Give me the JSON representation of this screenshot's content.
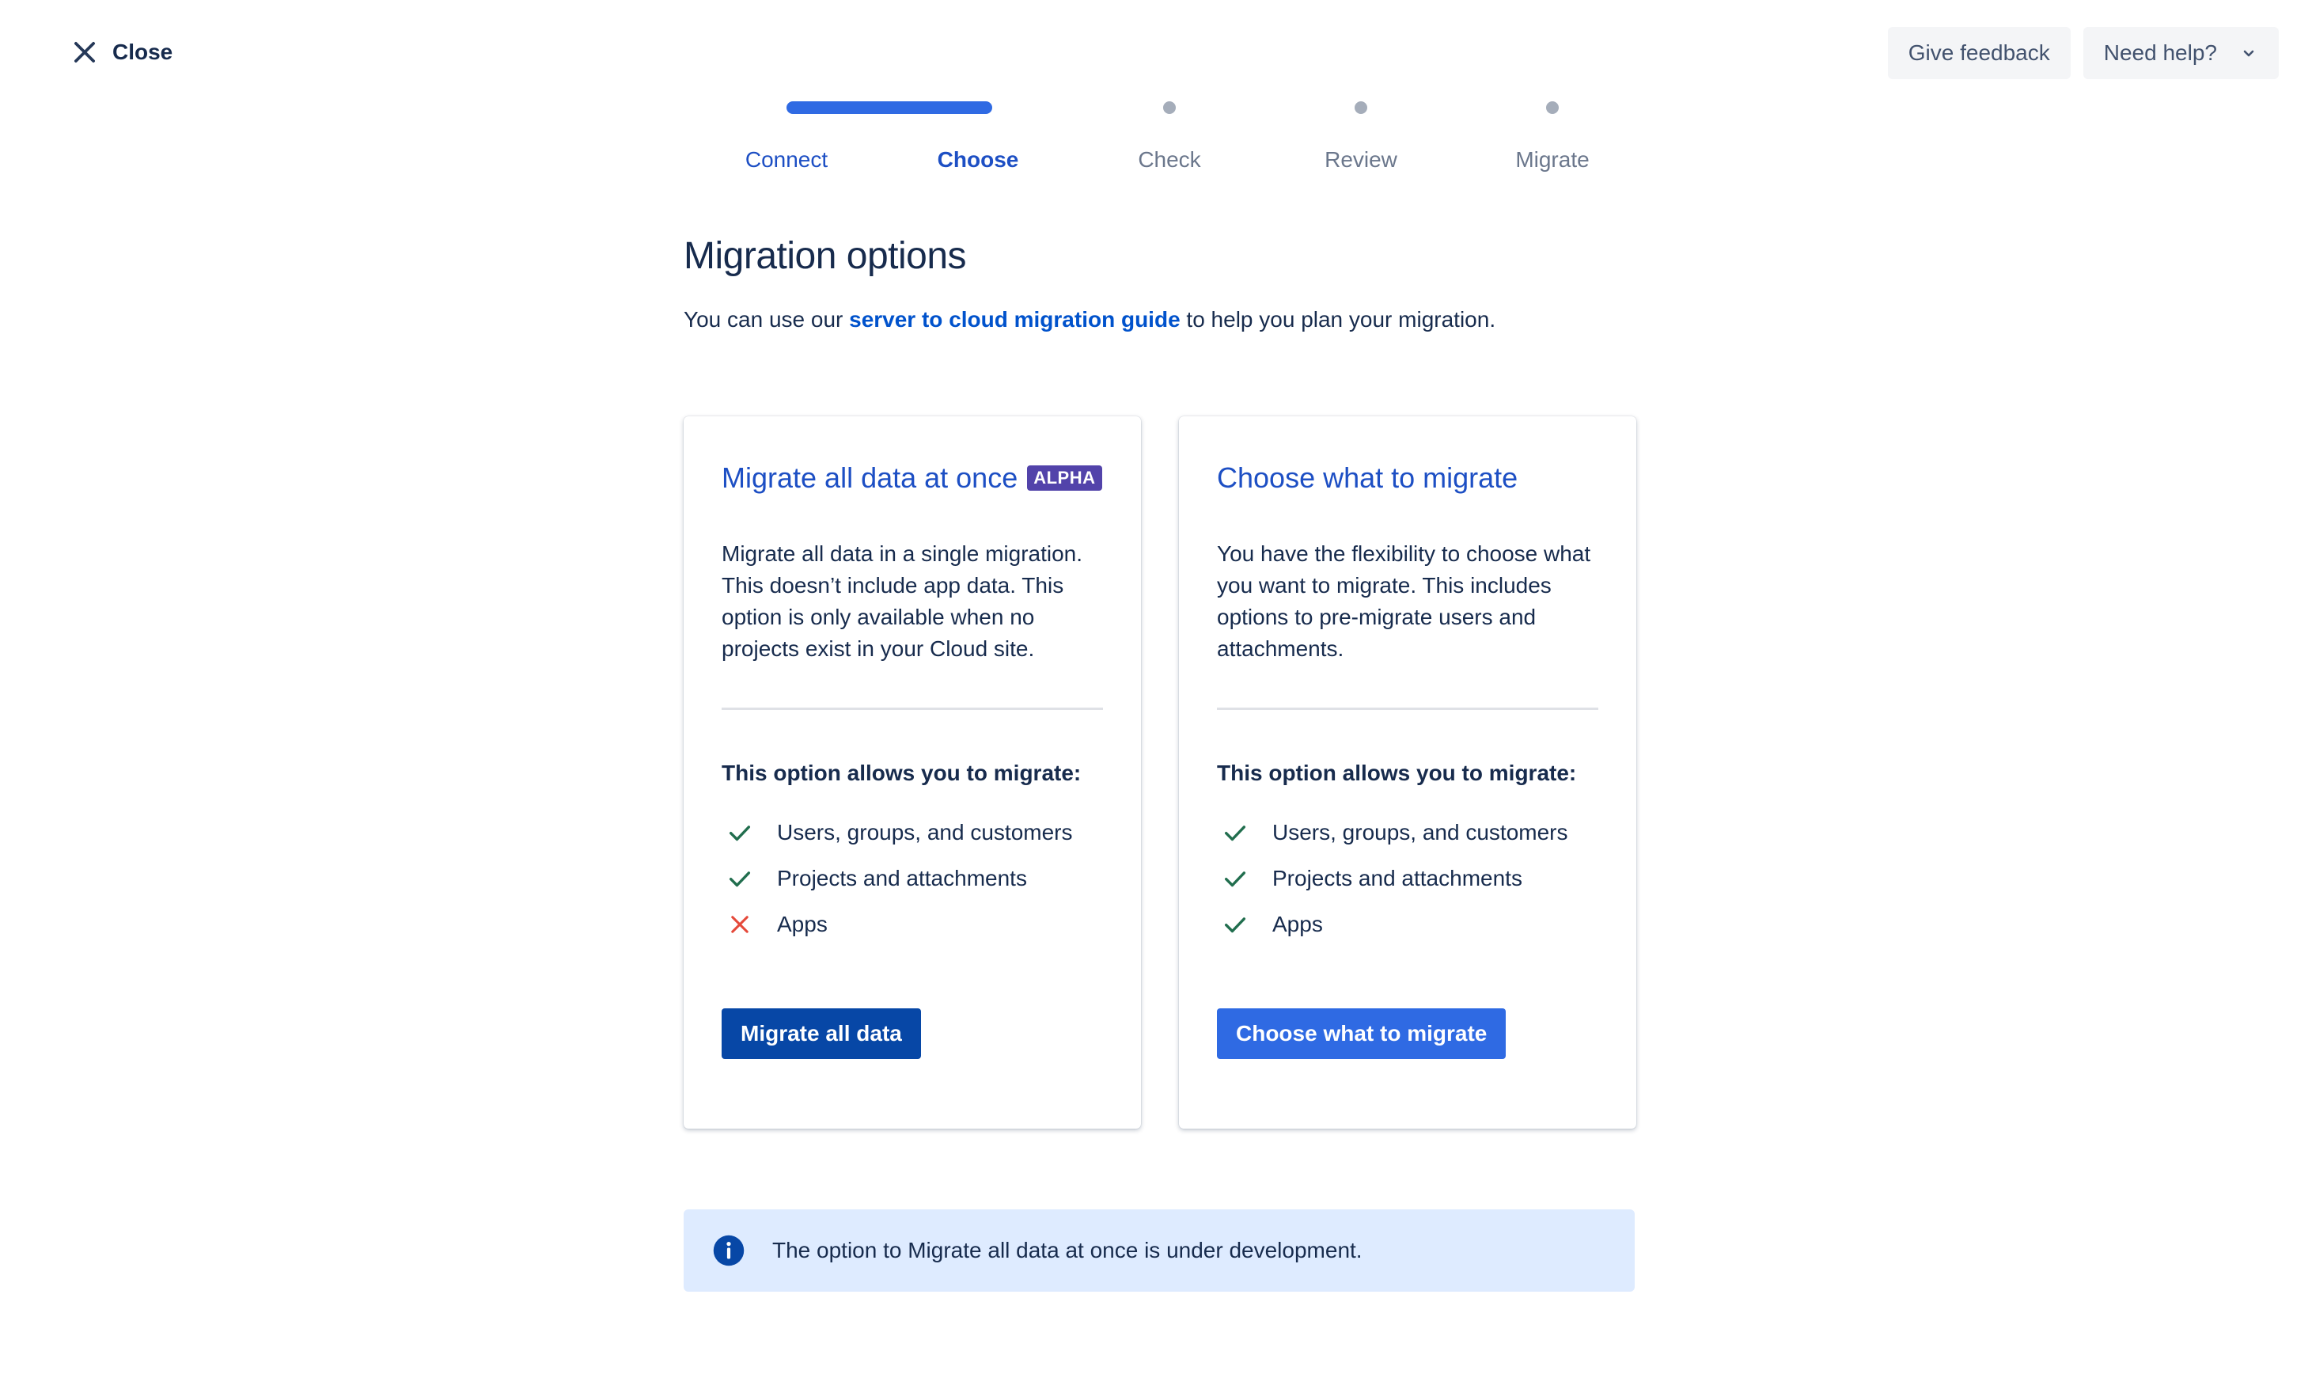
{
  "header": {
    "close_label": "Close",
    "feedback_label": "Give feedback",
    "help_label": "Need help?"
  },
  "progress": {
    "steps": [
      {
        "label": "Connect",
        "state": "done"
      },
      {
        "label": "Choose",
        "state": "current"
      },
      {
        "label": "Check",
        "state": "todo"
      },
      {
        "label": "Review",
        "state": "todo"
      },
      {
        "label": "Migrate",
        "state": "todo"
      }
    ]
  },
  "main": {
    "title": "Migration options",
    "intro_before": "You can use our ",
    "intro_link": "server to cloud migration guide",
    "intro_after": " to help you plan your migration."
  },
  "cards": [
    {
      "title": "Migrate all data at once",
      "badge": "ALPHA",
      "description": "Migrate all data in a single migration. This doesn’t include app data. This option is only available when no projects exist in your Cloud site.",
      "allows_title": "This option allows you to migrate:",
      "features": [
        {
          "label": "Users, groups, and customers",
          "icon": "check-icon"
        },
        {
          "label": "Projects and attachments",
          "icon": "check-icon"
        },
        {
          "label": "Apps",
          "icon": "cross-icon"
        }
      ],
      "button_label": "Migrate all data"
    },
    {
      "title": "Choose what to migrate",
      "description": "You have the flexibility to choose what you want to migrate. This includes options to pre-migrate users and attachments.",
      "allows_title": "This option allows you to migrate:",
      "features": [
        {
          "label": "Users, groups, and customers",
          "icon": "check-icon"
        },
        {
          "label": "Projects and attachments",
          "icon": "check-icon"
        },
        {
          "label": "Apps",
          "icon": "check-icon"
        }
      ],
      "button_label": "Choose what to migrate"
    }
  ],
  "info_banner": {
    "icon": "info-icon",
    "text": "The option to Migrate all data at once is under development."
  },
  "colors": {
    "primary_blue": "#2f6ae3",
    "dark_blue": "#0747a6",
    "link_blue": "#0052cc",
    "heading": "#172b4d",
    "success_green": "#36b37e",
    "error_red": "#de350b",
    "alpha_purple": "#5243aa",
    "info_bg": "#deebff"
  }
}
